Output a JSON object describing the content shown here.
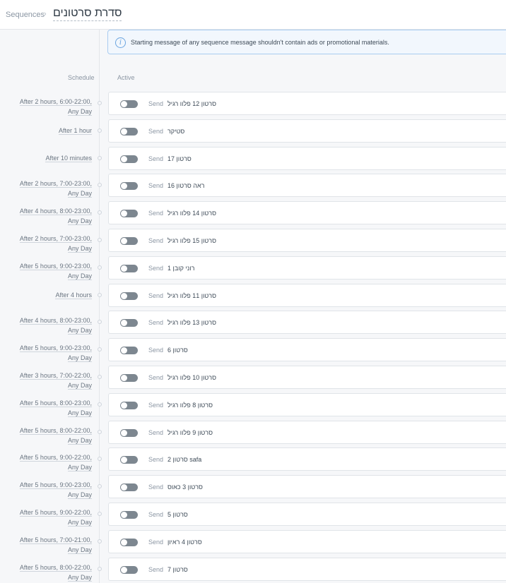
{
  "breadcrumb": {
    "root": "Sequences",
    "separator": "›",
    "title": "סדרת סרטונים"
  },
  "notice": {
    "text": "Starting message of any sequence message shouldn't contain ads or promotional materials."
  },
  "columns": {
    "schedule": "Schedule",
    "active": "Active"
  },
  "send_label": "Send",
  "rows": [
    {
      "schedule": [
        "After 2 hours, 6:00-22:00,",
        "Any Day"
      ],
      "message": "סרטון 12 פלוו רגיל"
    },
    {
      "schedule": [
        "After 1 hour"
      ],
      "message": "סטיקר"
    },
    {
      "schedule": [
        "After 10 minutes"
      ],
      "message": "סרטון 17"
    },
    {
      "schedule": [
        "After 2 hours, 7:00-23:00,",
        "Any Day"
      ],
      "message": "ראה סרטון 16"
    },
    {
      "schedule": [
        "After 4 hours, 8:00-23:00,",
        "Any Day"
      ],
      "message": "סרטון 14 פלוו רגיל"
    },
    {
      "schedule": [
        "After 2 hours, 7:00-23:00,",
        "Any Day"
      ],
      "message": "סרטון 15 פלוו רגיל"
    },
    {
      "schedule": [
        "After 5 hours, 9:00-23:00,",
        "Any Day"
      ],
      "message": "רוני קובן 1"
    },
    {
      "schedule": [
        "After 4 hours"
      ],
      "message": "סרטון 11 פלוו רגיל"
    },
    {
      "schedule": [
        "After 4 hours, 8:00-23:00,",
        "Any Day"
      ],
      "message": "סרטון 13 פלוו רגיל"
    },
    {
      "schedule": [
        "After 5 hours, 9:00-23:00,",
        "Any Day"
      ],
      "message": "סרטון 6"
    },
    {
      "schedule": [
        "After 3 hours, 7:00-22:00,",
        "Any Day"
      ],
      "message": "סרטון 10 פלוו רגיל"
    },
    {
      "schedule": [
        "After 5 hours, 8:00-23:00,",
        "Any Day"
      ],
      "message": "סרטון 8 פלוו רגיל"
    },
    {
      "schedule": [
        "After 5 hours, 8:00-22:00,",
        "Any Day"
      ],
      "message": "סרטון 9 פלוו רגיל"
    },
    {
      "schedule": [
        "After 5 hours, 9:00-22:00,",
        "Any Day"
      ],
      "message": "סרטון 2 safa"
    },
    {
      "schedule": [
        "After 5 hours, 9:00-23:00,",
        "Any Day"
      ],
      "message": "סרטון 3 כאוס"
    },
    {
      "schedule": [
        "After 5 hours, 9:00-22:00,",
        "Any Day"
      ],
      "message": "סרטון 5"
    },
    {
      "schedule": [
        "After 5 hours, 7:00-21:00,",
        "Any Day"
      ],
      "message": "סרטון 4 ראיון"
    },
    {
      "schedule": [
        "After 5 hours, 8:00-22:00,",
        "Any Day"
      ],
      "message": "סרטון 7"
    }
  ],
  "colors": {
    "accent": "#6ba5e0",
    "toggle_off": "#7d8790"
  }
}
